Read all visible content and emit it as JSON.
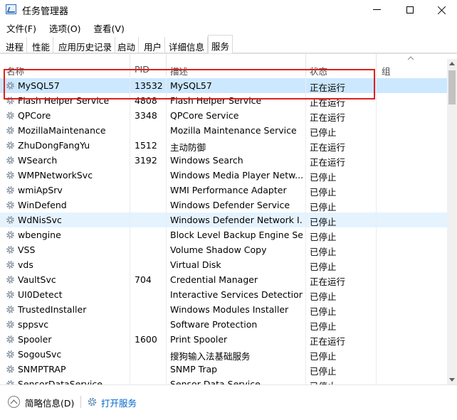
{
  "window": {
    "title": "任务管理器"
  },
  "menu": [
    "文件(F)",
    "选项(O)",
    "查看(V)"
  ],
  "tabs": [
    {
      "label": "进程",
      "active": false
    },
    {
      "label": "性能",
      "active": false
    },
    {
      "label": "应用历史记录",
      "active": false
    },
    {
      "label": "启动",
      "active": false
    },
    {
      "label": "用户",
      "active": false
    },
    {
      "label": "详细信息",
      "active": false
    },
    {
      "label": "服务",
      "active": true
    }
  ],
  "table": {
    "columns": {
      "name": "名称",
      "pid": "PID",
      "desc": "描述",
      "status": "状态",
      "group": "组"
    },
    "rows": [
      {
        "name": "MySQL57",
        "pid": "13532",
        "desc": "MySQL57",
        "status": "正在运行",
        "group": "",
        "state": "selected"
      },
      {
        "name": "Flash Helper Service",
        "pid": "4808",
        "desc": "Flash Helper Service",
        "status": "正在运行",
        "group": ""
      },
      {
        "name": "QPCore",
        "pid": "3348",
        "desc": "QPCore Service",
        "status": "正在运行",
        "group": ""
      },
      {
        "name": "MozillaMaintenance",
        "pid": "",
        "desc": "Mozilla Maintenance Service",
        "status": "已停止",
        "group": ""
      },
      {
        "name": "ZhuDongFangYu",
        "pid": "1512",
        "desc": "主动防御",
        "status": "正在运行",
        "group": ""
      },
      {
        "name": "WSearch",
        "pid": "3192",
        "desc": "Windows Search",
        "status": "正在运行",
        "group": ""
      },
      {
        "name": "WMPNetworkSvc",
        "pid": "",
        "desc": "Windows Media Player Netw...",
        "status": "已停止",
        "group": ""
      },
      {
        "name": "wmiApSrv",
        "pid": "",
        "desc": "WMI Performance Adapter",
        "status": "已停止",
        "group": ""
      },
      {
        "name": "WinDefend",
        "pid": "",
        "desc": "Windows Defender Service",
        "status": "已停止",
        "group": ""
      },
      {
        "name": "WdNisSvc",
        "pid": "",
        "desc": "Windows Defender Network I...",
        "status": "已停止",
        "group": "",
        "state": "highlight"
      },
      {
        "name": "wbengine",
        "pid": "",
        "desc": "Block Level Backup Engine Se...",
        "status": "已停止",
        "group": ""
      },
      {
        "name": "VSS",
        "pid": "",
        "desc": "Volume Shadow Copy",
        "status": "已停止",
        "group": ""
      },
      {
        "name": "vds",
        "pid": "",
        "desc": "Virtual Disk",
        "status": "已停止",
        "group": ""
      },
      {
        "name": "VaultSvc",
        "pid": "704",
        "desc": "Credential Manager",
        "status": "正在运行",
        "group": ""
      },
      {
        "name": "UI0Detect",
        "pid": "",
        "desc": "Interactive Services Detection",
        "status": "已停止",
        "group": ""
      },
      {
        "name": "TrustedInstaller",
        "pid": "",
        "desc": "Windows Modules Installer",
        "status": "已停止",
        "group": ""
      },
      {
        "name": "sppsvc",
        "pid": "",
        "desc": "Software Protection",
        "status": "已停止",
        "group": ""
      },
      {
        "name": "Spooler",
        "pid": "1600",
        "desc": "Print Spooler",
        "status": "正在运行",
        "group": ""
      },
      {
        "name": "SogouSvc",
        "pid": "",
        "desc": "搜狗输入法基础服务",
        "status": "已停止",
        "group": ""
      },
      {
        "name": "SNMPTRAP",
        "pid": "",
        "desc": "SNMP Trap",
        "status": "已停止",
        "group": ""
      },
      {
        "name": "SensorDataService",
        "pid": "",
        "desc": "Sensor Data Service",
        "status": "已停止",
        "group": ""
      }
    ]
  },
  "footer": {
    "fewer_details": "简略信息(D)",
    "open_services": "打开服务"
  },
  "colors": {
    "selected_row": "#cce8ff",
    "highlight_row": "#e5f3ff",
    "annotation_box": "#e0201b",
    "link": "#0066cc"
  },
  "icons": {
    "service": "gear-icon",
    "fewer_details": "chevron-up-circle-icon",
    "open_services": "gear-icon"
  }
}
